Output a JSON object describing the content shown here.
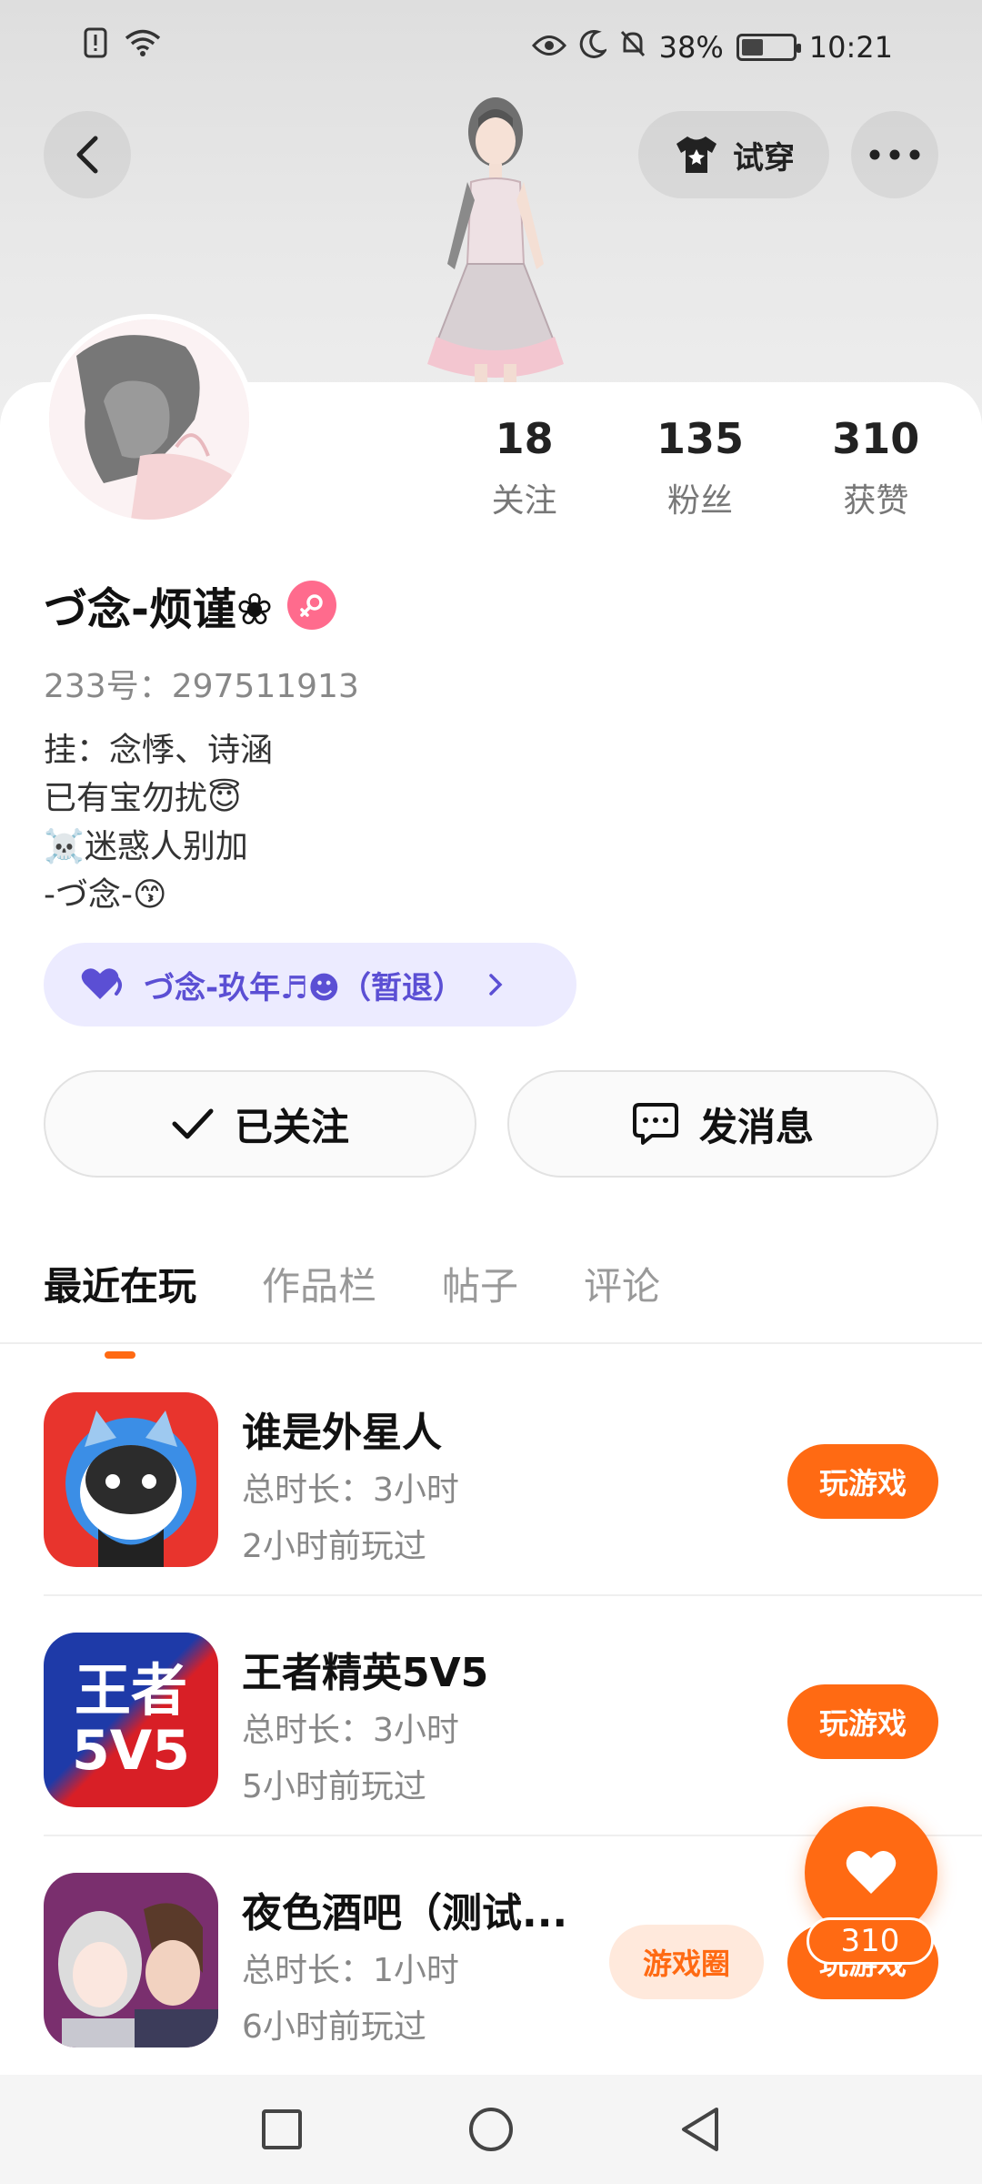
{
  "status_bar": {
    "battery": "38%",
    "time": "10:21"
  },
  "header": {
    "try_on_label": "试穿"
  },
  "profile": {
    "stats": [
      {
        "value": "18",
        "label": "关注"
      },
      {
        "value": "135",
        "label": "粉丝"
      },
      {
        "value": "310",
        "label": "获赞"
      }
    ],
    "name": "づ念-烦谨❀",
    "uid": "233号：297511913",
    "bio": [
      "挂：念悸、诗涵",
      "已有宝勿扰😇",
      "☠️迷惑人别加",
      "-づ念-😙"
    ],
    "tag_label": "づ念-玖年♬☻（暂退）"
  },
  "actions": {
    "follow_label": "已关注",
    "message_label": "发消息"
  },
  "tabs": [
    {
      "label": "最近在玩",
      "active": true
    },
    {
      "label": "作品栏",
      "active": false
    },
    {
      "label": "帖子",
      "active": false
    },
    {
      "label": "评论",
      "active": false
    }
  ],
  "games": [
    {
      "title": "谁是外星人",
      "duration": "总时长：3小时",
      "last_played": "2小时前玩过",
      "play_label": "玩游戏"
    },
    {
      "title": "王者精英5V5",
      "duration": "总时长：3小时",
      "last_played": "5小时前玩过",
      "play_label": "玩游戏",
      "icon_text_top": "王者",
      "icon_text_bottom": "5V5"
    },
    {
      "title": "夜色酒吧（测试...",
      "duration": "总时长：1小时",
      "last_played": "6小时前玩过",
      "play_label": "玩游戏",
      "circle_label": "游戏圈"
    }
  ],
  "like_fab": {
    "count": "310"
  },
  "colors": {
    "accent": "#ff6a13",
    "tag_bg": "#ecebff",
    "tag_text": "#5b4fd4",
    "gender": "#ff6b8d"
  }
}
